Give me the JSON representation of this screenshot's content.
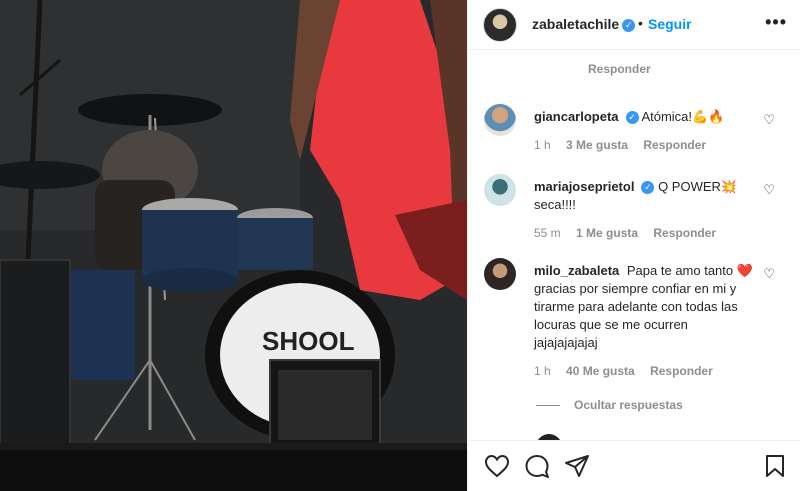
{
  "post": {
    "username": "zabaletachile",
    "separator": "•",
    "follow_label": "Seguir",
    "more_icon": "•••"
  },
  "comments": {
    "top_reply_label": "Responder",
    "items": [
      {
        "username": "giancarlopeta",
        "verified": true,
        "text": "Atómica!💪🔥",
        "time": "1 h",
        "likes": "3 Me gusta",
        "reply": "Responder"
      },
      {
        "username": "mariajoseprietol",
        "verified": true,
        "text": "Q POWER💥 seca!!!!",
        "time": "55 m",
        "likes": "1 Me gusta",
        "reply": "Responder"
      },
      {
        "username": "milo_zabaleta",
        "verified": false,
        "text": "Papa te amo tanto ❤️ gracias por siempre confiar en mi y tirarme para adelante con todas las locuras que se me ocurren jajajajajajaj",
        "time": "1 h",
        "likes": "40 Me gusta",
        "reply": "Responder"
      }
    ],
    "hide_replies_label": "Ocultar respuestas"
  },
  "actions": {
    "like_icon": "heart-icon",
    "comment_icon": "comment-icon",
    "share_icon": "paper-plane-icon",
    "save_icon": "bookmark-icon"
  },
  "colors": {
    "link_blue": "#0095f6",
    "verified_blue": "#3897f0",
    "muted": "#8e8e8e"
  }
}
